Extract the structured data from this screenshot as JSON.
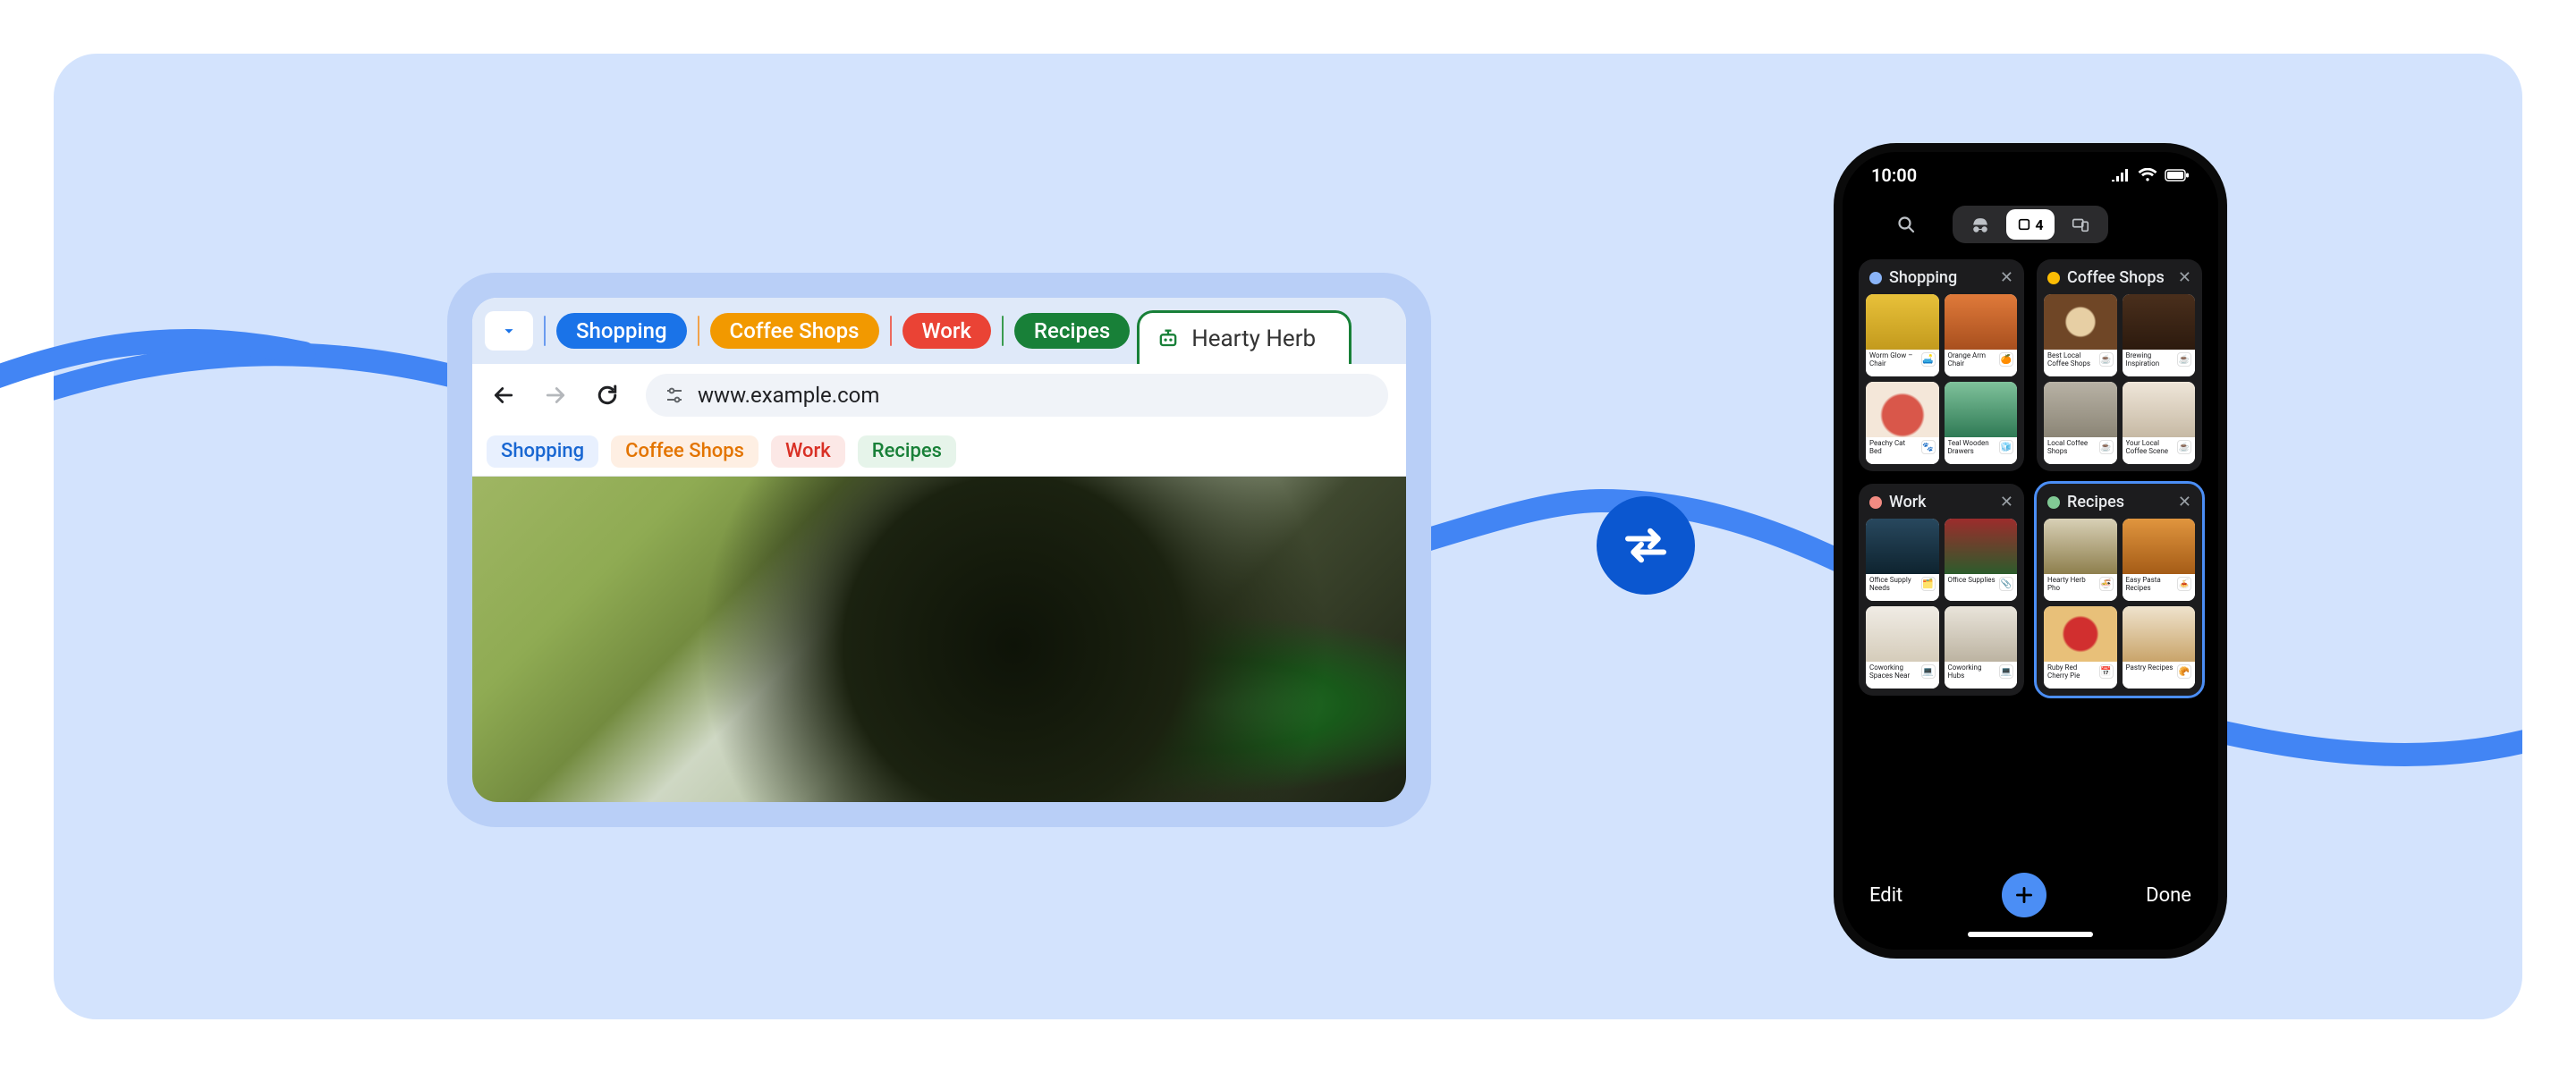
{
  "desktop": {
    "groups": [
      {
        "label": "Shopping",
        "color": "blue"
      },
      {
        "label": "Coffee Shops",
        "color": "orange"
      },
      {
        "label": "Work",
        "color": "red"
      },
      {
        "label": "Recipes",
        "color": "green"
      }
    ],
    "active_tab_label": "Hearty Herb",
    "url": "www.example.com",
    "chips": [
      {
        "label": "Shopping",
        "color": "blue"
      },
      {
        "label": "Coffee Shops",
        "color": "orange"
      },
      {
        "label": "Work",
        "color": "red"
      },
      {
        "label": "Recipes",
        "color": "green"
      }
    ]
  },
  "phone": {
    "time": "10:00",
    "tab_count": "4",
    "edit_label": "Edit",
    "done_label": "Done",
    "groups": [
      {
        "label": "Shopping",
        "dot": "blue",
        "selected": false,
        "thumbs": [
          {
            "title": "Worm Glow – Chair",
            "img": "im-chair",
            "icon": "🛋️"
          },
          {
            "title": "Orange Arm Chair",
            "img": "im-armch",
            "icon": "🍊"
          },
          {
            "title": "Peachy Cat Bed",
            "img": "im-apple",
            "icon": "🐾"
          },
          {
            "title": "Teal Wooden Drawers",
            "img": "im-snowg",
            "icon": "🧊"
          }
        ]
      },
      {
        "label": "Coffee Shops",
        "dot": "orange",
        "selected": false,
        "thumbs": [
          {
            "title": "Best Local Coffee Shops",
            "img": "im-latte",
            "icon": "☕"
          },
          {
            "title": "Brewing Inspiration",
            "img": "im-bean",
            "icon": "☕"
          },
          {
            "title": "Local Coffee Shops",
            "img": "im-laptop",
            "icon": "☕"
          },
          {
            "title": "Your Local Coffee Scene",
            "img": "im-mug",
            "icon": "☕"
          }
        ]
      },
      {
        "label": "Work",
        "dot": "red",
        "selected": false,
        "thumbs": [
          {
            "title": "Office Supply Needs",
            "img": "im-desk",
            "icon": "🗂️"
          },
          {
            "title": "Office Supplies",
            "img": "im-pens",
            "icon": "📎"
          },
          {
            "title": "Coworking Spaces Near",
            "img": "im-open",
            "icon": "💻"
          },
          {
            "title": "Coworking Hubs",
            "img": "im-meet",
            "icon": "💻"
          }
        ]
      },
      {
        "label": "Recipes",
        "dot": "green",
        "selected": true,
        "thumbs": [
          {
            "title": "Hearty Herb Pho",
            "img": "im-pho",
            "icon": "🍜"
          },
          {
            "title": "Easy Pasta Recipes",
            "img": "im-pasta",
            "icon": "🍝"
          },
          {
            "title": "Ruby Red Cherry Pie",
            "img": "im-pie",
            "icon": "📅"
          },
          {
            "title": "Pastry Recipes",
            "img": "im-pastry",
            "icon": "🥐"
          }
        ]
      }
    ]
  }
}
